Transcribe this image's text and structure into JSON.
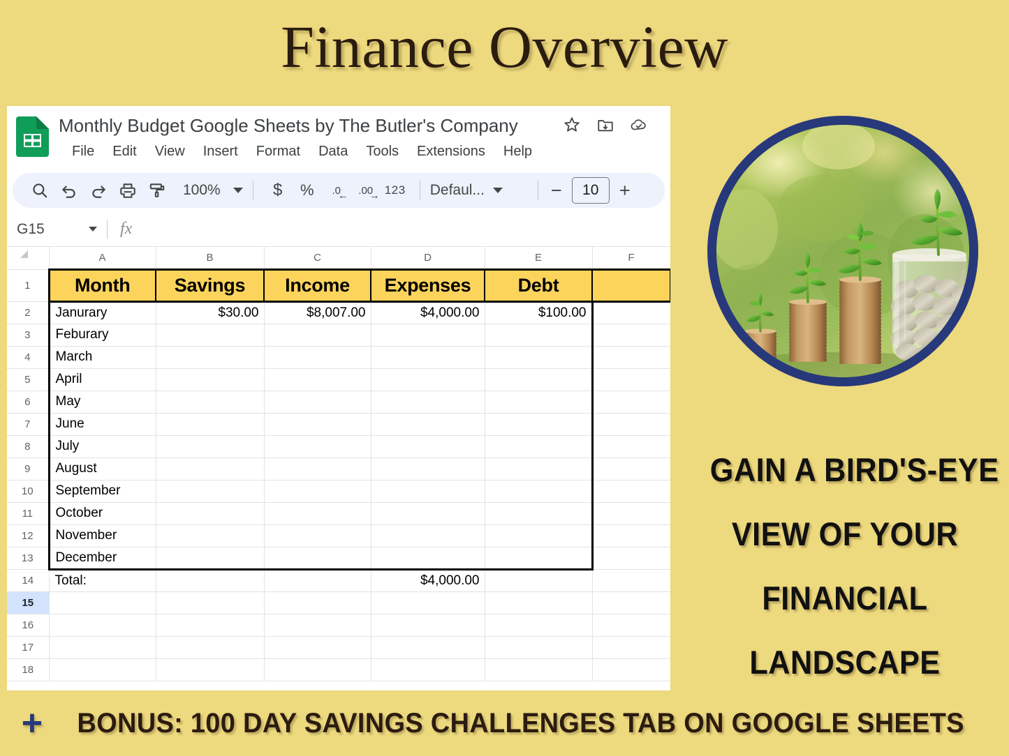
{
  "poster": {
    "title": "Finance Overview",
    "background_color": "#EDD97E",
    "accent_navy": "#27397A",
    "header_cell_color": "#FCD45C"
  },
  "sheets": {
    "logo_icon": "google-sheets-icon",
    "doc_title": "Monthly Budget Google Sheets by The Butler's Company",
    "title_icons": [
      {
        "name": "star-icon",
        "label": "Star"
      },
      {
        "name": "move-to-folder-icon",
        "label": "Move"
      },
      {
        "name": "cloud-saved-icon",
        "label": "Saved to Drive"
      }
    ],
    "menus": [
      "File",
      "Edit",
      "View",
      "Insert",
      "Format",
      "Data",
      "Tools",
      "Extensions",
      "Help"
    ],
    "toolbar": {
      "search_icon": "search-icon",
      "undo_icon": "undo-icon",
      "redo_icon": "redo-icon",
      "print_icon": "print-icon",
      "paint_format_icon": "paint-format-icon",
      "zoom_value": "100%",
      "currency_label": "$",
      "percent_label": "%",
      "decrease_decimal_label": ".0",
      "increase_decimal_label": ".00",
      "number_format_label": "123",
      "font_name": "Defaul...",
      "font_size_minus": "−",
      "font_size_value": "10",
      "font_size_plus": "+"
    },
    "formula_bar": {
      "name_box_value": "G15",
      "fx_label": "fx",
      "formula_value": ""
    },
    "grid": {
      "column_headers": [
        "A",
        "B",
        "C",
        "D",
        "E",
        "F"
      ],
      "row_numbers": [
        "1",
        "2",
        "3",
        "4",
        "5",
        "6",
        "7",
        "8",
        "9",
        "10",
        "11",
        "12",
        "13",
        "14",
        "15",
        "16",
        "17",
        "18"
      ],
      "selected_row": "15",
      "selected_cell": "G15",
      "table_headers": [
        "Month",
        "Savings",
        "Income",
        "Expenses",
        "Debt"
      ],
      "rows": [
        {
          "row": "2",
          "month": "Janurary",
          "savings": "$30.00",
          "income": "$8,007.00",
          "expenses": "$4,000.00",
          "debt": "$100.00"
        },
        {
          "row": "3",
          "month": "Feburary",
          "savings": "",
          "income": "",
          "expenses": "",
          "debt": ""
        },
        {
          "row": "4",
          "month": "March",
          "savings": "",
          "income": "",
          "expenses": "",
          "debt": ""
        },
        {
          "row": "5",
          "month": "April",
          "savings": "",
          "income": "",
          "expenses": "",
          "debt": ""
        },
        {
          "row": "6",
          "month": "May",
          "savings": "",
          "income": "",
          "expenses": "",
          "debt": ""
        },
        {
          "row": "7",
          "month": "June",
          "savings": "",
          "income": "",
          "expenses": "",
          "debt": ""
        },
        {
          "row": "8",
          "month": "July",
          "savings": "",
          "income": "",
          "expenses": "",
          "debt": ""
        },
        {
          "row": "9",
          "month": "August",
          "savings": "",
          "income": "",
          "expenses": "",
          "debt": ""
        },
        {
          "row": "10",
          "month": "September",
          "savings": "",
          "income": "",
          "expenses": "",
          "debt": ""
        },
        {
          "row": "11",
          "month": "October",
          "savings": "",
          "income": "",
          "expenses": "",
          "debt": ""
        },
        {
          "row": "12",
          "month": "November",
          "savings": "",
          "income": "",
          "expenses": "",
          "debt": ""
        },
        {
          "row": "13",
          "month": "December",
          "savings": "",
          "income": "",
          "expenses": "",
          "debt": ""
        }
      ],
      "total_row": {
        "row": "14",
        "label": "Total:",
        "savings": "",
        "income": "",
        "expenses": "$4,000.00",
        "debt": ""
      },
      "empty_rows": [
        "15",
        "16",
        "17",
        "18"
      ]
    }
  },
  "photo": {
    "name": "coin-stacks-with-plants-photo",
    "alt": "Stacks of coins with green seedlings growing and a jar of coins"
  },
  "tagline": {
    "lines": [
      "GAIN A BIRD'S-EYE",
      "VIEW OF YOUR",
      "FINANCIAL",
      "LANDSCAPE"
    ]
  },
  "bonus": {
    "plus_glyph": "+",
    "text": "BONUS: 100 DAY SAVINGS CHALLENGES TAB ON GOOGLE SHEETS"
  }
}
